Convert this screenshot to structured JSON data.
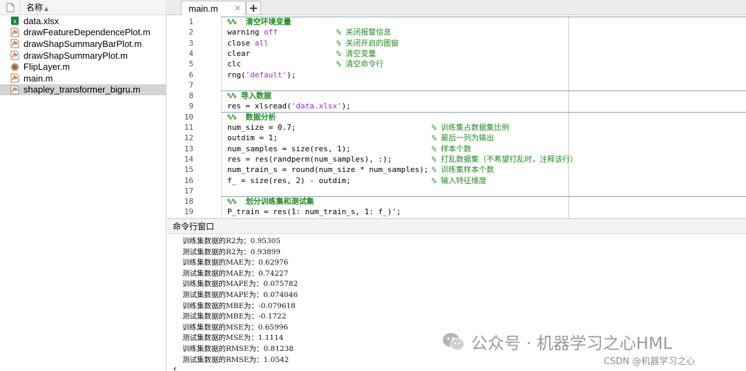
{
  "file_browser": {
    "header_label": "名称",
    "files": [
      {
        "name": "data.xlsx",
        "icon": "excel-icon"
      },
      {
        "name": "drawFeatureDependencePlot.m",
        "icon": "m-file-icon"
      },
      {
        "name": "drawShapSummaryBarPlot.m",
        "icon": "m-file-icon"
      },
      {
        "name": "drawShapSummaryPlot.m",
        "icon": "m-file-icon"
      },
      {
        "name": "FlipLayer.m",
        "icon": "class-file-icon"
      },
      {
        "name": "main.m",
        "icon": "m-file-icon"
      },
      {
        "name": "shapley_transformer_bigru.m",
        "icon": "m-file-icon",
        "selected": true
      }
    ]
  },
  "editor": {
    "tab_label": "main.m",
    "lines": [
      {
        "n": "1",
        "parts": [
          [
            "sec",
            "%%  清空环境变量"
          ]
        ]
      },
      {
        "n": "2",
        "parts": [
          [
            "",
            "warning "
          ],
          [
            "str",
            "off"
          ]
        ],
        "comment": "% 关闭报警信息"
      },
      {
        "n": "3",
        "parts": [
          [
            "",
            "close "
          ],
          [
            "str",
            "all"
          ]
        ],
        "comment": "% 关闭开启的图窗"
      },
      {
        "n": "4",
        "parts": [
          [
            "",
            "clear"
          ]
        ],
        "comment": "% 清空变量"
      },
      {
        "n": "5",
        "parts": [
          [
            "",
            "clc"
          ]
        ],
        "comment": "% 清空命令行"
      },
      {
        "n": "6",
        "parts": [
          [
            "",
            "rng("
          ],
          [
            "str",
            "'default'"
          ],
          [
            "",
            ");"
          ]
        ]
      },
      {
        "n": "7",
        "parts": []
      },
      {
        "n": "8",
        "parts": [
          [
            "sec",
            "%% 导入数据"
          ]
        ]
      },
      {
        "n": "9",
        "parts": [
          [
            "",
            "res = xlsread("
          ],
          [
            "str",
            "'data.xlsx'"
          ],
          [
            "",
            ");"
          ]
        ]
      },
      {
        "n": "10",
        "parts": [
          [
            "sec",
            "%%  数据分析"
          ]
        ]
      },
      {
        "n": "11",
        "parts": [
          [
            "",
            "num_size = 0.7;"
          ]
        ],
        "comment2": "% 训练集占数据集比例"
      },
      {
        "n": "12",
        "parts": [
          [
            "",
            "outdim = 1;"
          ]
        ],
        "comment2": "% 最后一列为输出"
      },
      {
        "n": "13",
        "parts": [
          [
            "",
            "num_samples = size(res, 1);"
          ]
        ],
        "comment2": "% 样本个数"
      },
      {
        "n": "14",
        "parts": [
          [
            "",
            "res = res(randperm(num_samples), :);"
          ]
        ],
        "comment2": "% 打乱数据集（不希望打乱时，注释该行）"
      },
      {
        "n": "15",
        "parts": [
          [
            "",
            "num_train_s = round(num_size * num_samples);"
          ]
        ],
        "comment2": "% 训练集样本个数"
      },
      {
        "n": "16",
        "parts": [
          [
            "",
            "f_ = size(res, 2) - outdim;"
          ]
        ],
        "comment2": "% 输入特征维度"
      },
      {
        "n": "17",
        "parts": []
      },
      {
        "n": "18",
        "parts": [
          [
            "sec",
            "%%  划分训练集和测试集"
          ]
        ]
      },
      {
        "n": "19",
        "parts": [
          [
            "",
            "P_train = res(1: num_train_s, 1: f_)';"
          ]
        ]
      }
    ]
  },
  "command_window": {
    "title": "命令行窗口",
    "output": [
      "训练集数据的R2为：0.95305",
      "测试集数据的R2为：0.93899",
      "训练集数据的MAE为：0.62976",
      "测试集数据的MAE为：0.74227",
      "训练集数据的MAPE为：0.075782",
      "测试集数据的MAPE为：0.074046",
      "训练集数据的MBE为：-0.079618",
      "测试集数据的MBE为：-0.1722",
      "训练集数据的MSE为：0.65996",
      "测试集数据的MSE为：1.1114",
      "训练集数据的RMSE为：0.81238",
      "测试集数据的RMSE为：1.0542"
    ],
    "prompt": "f"
  },
  "watermark": {
    "main": "公众号 · 机器学习之心HML",
    "sub": "CSDN @机器学习之心"
  },
  "colors": {
    "comment": "#228b22",
    "keyword_string": "#a020f0",
    "selected_row": "#d4d4d4"
  }
}
